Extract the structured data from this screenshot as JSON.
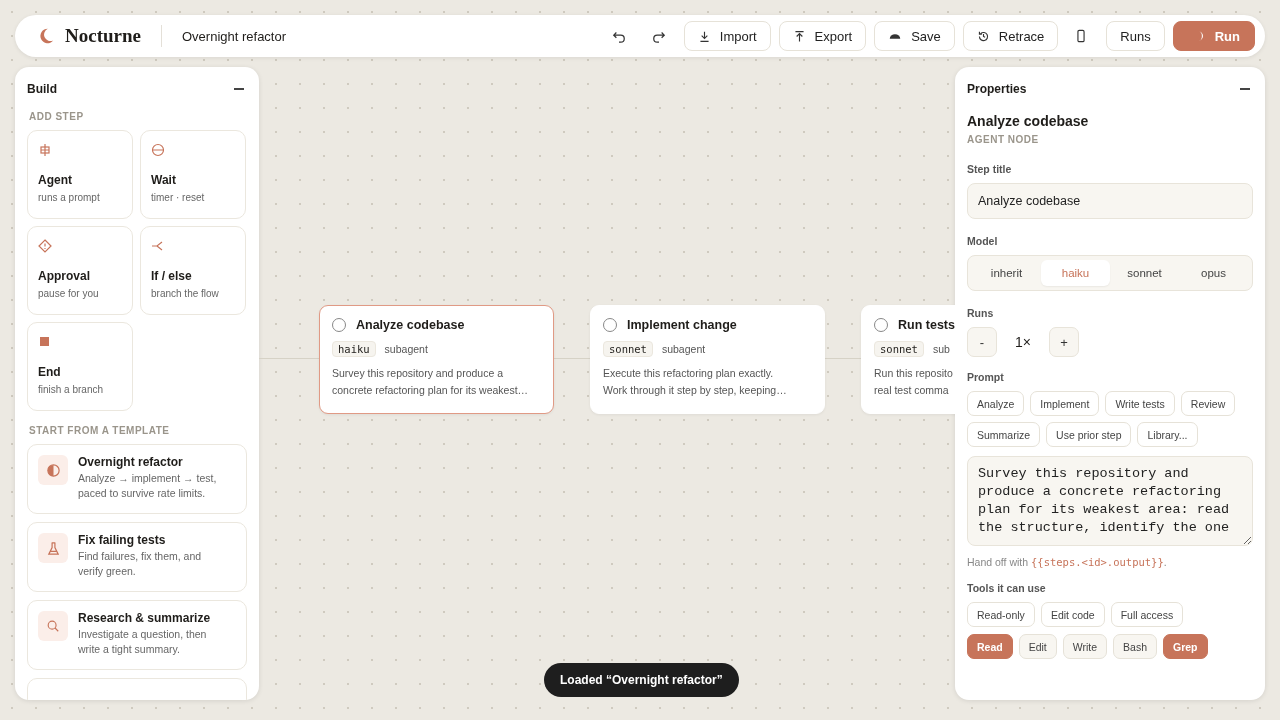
{
  "app": {
    "name": "Nocturne",
    "workflow_title": "Overnight refactor"
  },
  "toolbar": [
    {
      "kind": "undo"
    },
    {
      "kind": "redo"
    },
    {
      "kind": "import",
      "label": "Import"
    },
    {
      "kind": "export",
      "label": "Export"
    },
    {
      "kind": "save",
      "label": "Save"
    },
    {
      "kind": "retrace",
      "label": "Retrace"
    },
    {
      "kind": "device"
    },
    {
      "kind": "runs",
      "label": "Runs"
    },
    {
      "kind": "run",
      "label": "Run"
    }
  ],
  "build_panel": {
    "title": "Build",
    "steps_heading": "ADD STEP",
    "steps": [
      {
        "kind": "agent",
        "label": "Agent",
        "description": "runs a prompt"
      },
      {
        "kind": "wait",
        "label": "Wait",
        "description": "timer · reset"
      },
      {
        "kind": "approval",
        "label": "Approval",
        "description": "pause for you"
      },
      {
        "kind": "branch",
        "label": "If / else",
        "description": "branch the flow"
      },
      {
        "kind": "end",
        "label": "End",
        "description": "finish a branch"
      }
    ],
    "templates_heading": "START FROM A TEMPLATE",
    "templates": [
      {
        "kind": "refactor",
        "title": "Overnight refactor",
        "description": "Analyze → implement → test, paced to survive rate limits."
      },
      {
        "kind": "tests",
        "title": "Fix failing tests",
        "description": "Find failures, fix them, and verify green."
      },
      {
        "kind": "research",
        "title": "Research & summarize",
        "description": "Investigate a question, then write a tight summary."
      }
    ]
  },
  "canvas": {
    "nodes": [
      {
        "title": "Analyze codebase",
        "model": "haiku",
        "type": "subagent",
        "description": "Survey this repository and produce a\nconcrete refactoring plan for its weakest…",
        "selected": true
      },
      {
        "title": "Implement change",
        "model": "sonnet",
        "type": "subagent",
        "description": "Execute this refactoring plan exactly.\nWork through it step by step, keeping…",
        "selected": false
      },
      {
        "title": "Run tests",
        "model": "sonnet",
        "type": "sub",
        "description": "Run this reposito\nreal test comma",
        "selected": false
      }
    ]
  },
  "properties": {
    "title": "Properties",
    "node_title": "Analyze codebase",
    "node_kind": "AGENT NODE",
    "step_title_label": "Step title",
    "step_title_value": "Analyze codebase",
    "model_label": "Model",
    "models": [
      {
        "label": "inherit",
        "selected": false
      },
      {
        "label": "haiku",
        "selected": true
      },
      {
        "label": "sonnet",
        "selected": false
      },
      {
        "label": "opus",
        "selected": false
      }
    ],
    "runs_label": "Runs",
    "runs_minus": "-",
    "runs_value": "1×",
    "runs_plus": "+",
    "prompt_label": "Prompt",
    "prompt_chips": [
      "Analyze",
      "Implement",
      "Write tests",
      "Review",
      "Summarize",
      "Use prior step",
      "Library..."
    ],
    "prompt_value": "Survey this repository and produce a concrete refactoring plan for its weakest area: read the structure, identify the one",
    "handoff_prefix": "Hand off with",
    "handoff_code": "{{steps.<id>.output}}",
    "handoff_suffix": ".",
    "tools_label": "Tools it can use",
    "tool_presets": [
      "Read-only",
      "Edit code",
      "Full access"
    ],
    "tools": [
      {
        "label": "Read",
        "on": true
      },
      {
        "label": "Edit",
        "on": false
      },
      {
        "label": "Write",
        "on": false
      },
      {
        "label": "Bash",
        "on": false
      },
      {
        "label": "Grep",
        "on": true
      }
    ]
  },
  "toast": "Loaded “Overnight refactor”"
}
